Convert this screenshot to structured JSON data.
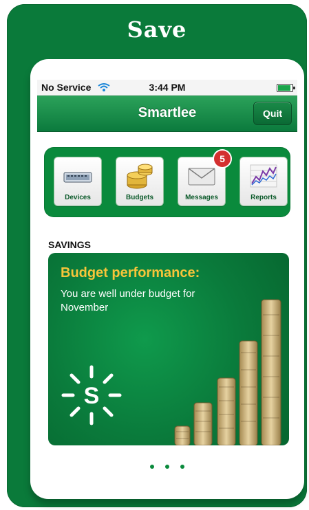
{
  "header": {
    "title": "Save"
  },
  "status": {
    "carrier": "No Service",
    "time": "3:44 PM"
  },
  "nav": {
    "title": "Smartlee",
    "quit_label": "Quit"
  },
  "icons": [
    {
      "label": "Devices"
    },
    {
      "label": "Budgets"
    },
    {
      "label": "Messages",
      "badge": "5"
    },
    {
      "label": "Reports"
    }
  ],
  "section": {
    "title": "SAVINGS"
  },
  "card": {
    "title": "Budget performance:",
    "text": "You are well under budget for November"
  },
  "colors": {
    "brand_green": "#0a7a3a",
    "accent_gold": "#f7c53a",
    "badge_red": "#d32f2f"
  }
}
